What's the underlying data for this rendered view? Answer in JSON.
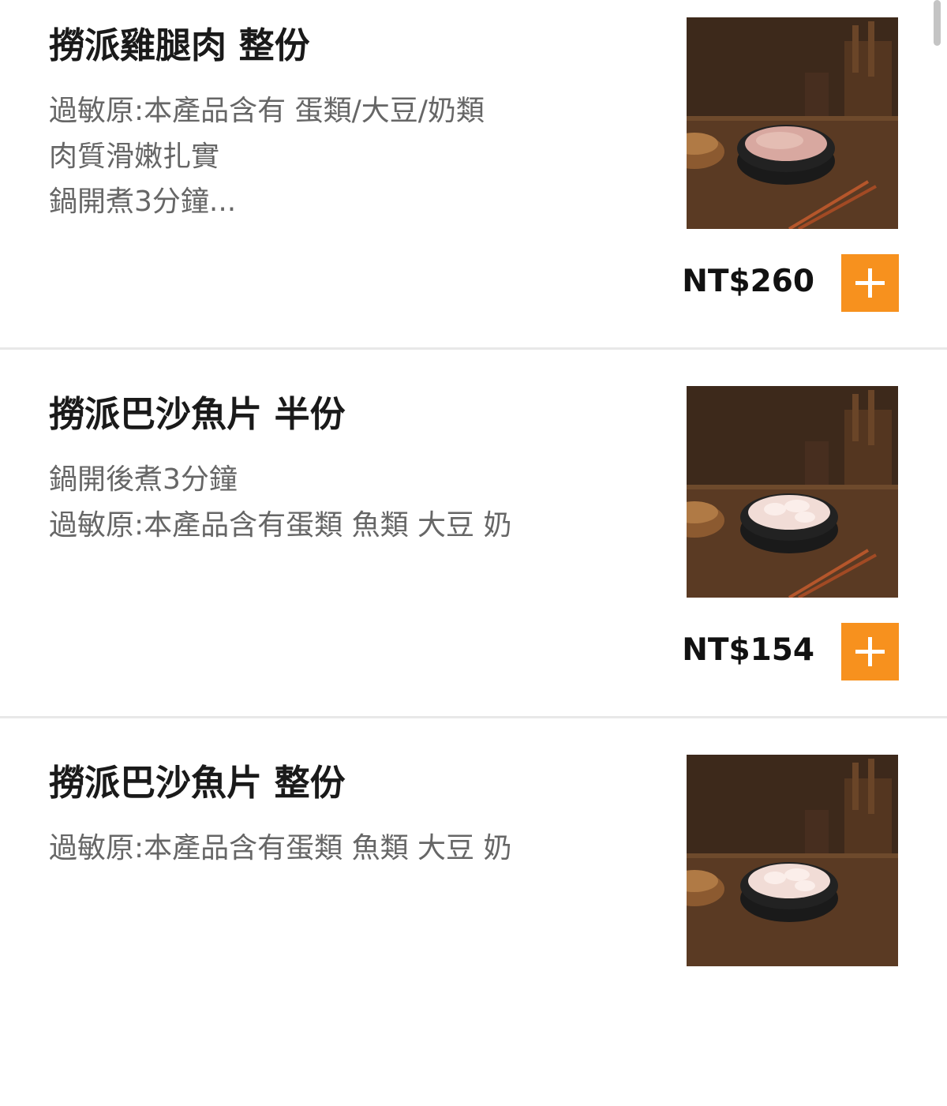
{
  "menu": {
    "items": [
      {
        "name": "撈派雞腿肉 整份",
        "description": [
          "過敏原:本產品含有 蛋類/大豆/奶類",
          "肉質滑嫩扎實",
          "鍋開煮3分鐘..."
        ],
        "price": "NT$260",
        "add_label": "+",
        "image": "chicken-thigh-bowl-photo"
      },
      {
        "name": "撈派巴沙魚片 半份",
        "description": [
          "鍋開後煮3分鐘",
          "過敏原:本產品含有蛋類 魚類 大豆 奶"
        ],
        "price": "NT$154",
        "add_label": "+",
        "image": "basa-fish-bowl-photo"
      },
      {
        "name": "撈派巴沙魚片 整份",
        "description": [
          "過敏原:本產品含有蛋類 魚類 大豆 奶"
        ],
        "image": "basa-fish-bowl-photo"
      }
    ]
  },
  "colors": {
    "accent": "#f7911e",
    "title": "#1a1a1a",
    "description": "#666666",
    "divider": "#e8e8e8"
  }
}
